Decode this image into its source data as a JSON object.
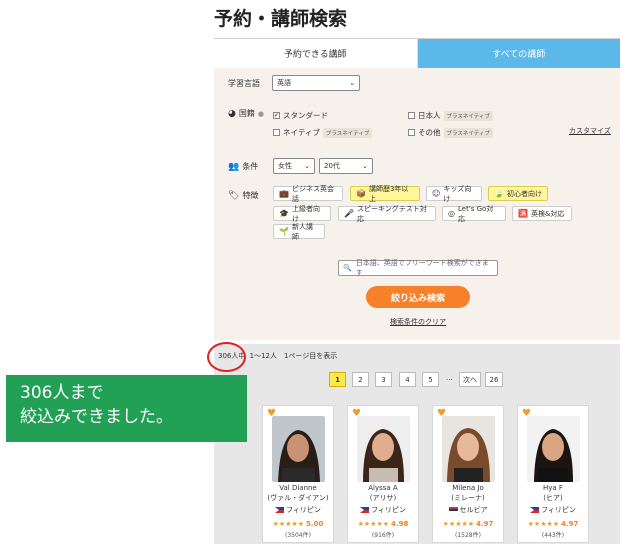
{
  "page_title": "予約・講師検索",
  "tabs": [
    {
      "label": "予約できる講師",
      "active": false
    },
    {
      "label": "すべての講師",
      "active": true
    }
  ],
  "filters": {
    "language_label": "学習言語",
    "language_value": "英語",
    "nationality_label": "国籍",
    "nationality_options": [
      {
        "label": "スタンダード",
        "checked": true,
        "badge": ""
      },
      {
        "label": "日本人",
        "checked": false,
        "badge": "プラスネイティブ"
      },
      {
        "label": "ネイティブ",
        "checked": false,
        "badge": "プラスネイティブ"
      },
      {
        "label": "その他",
        "checked": false,
        "badge": "プラスネイティブ"
      }
    ],
    "customize_link": "カスタマイズ",
    "condition_label": "条件",
    "gender_value": "女性",
    "age_value": "20代",
    "features_label": "特徴",
    "features": [
      {
        "label": "ビジネス英会話",
        "active": false,
        "icon": "briefcase-icon"
      },
      {
        "label": "講師歴3年以上",
        "active": true,
        "icon": "cube-icon"
      },
      {
        "label": "キッズ向け",
        "active": false,
        "icon": "smile-icon"
      },
      {
        "label": "初心者向け",
        "active": true,
        "icon": "leaf-icon"
      },
      {
        "label": "上級者向け",
        "active": false,
        "icon": "graduation-cap-icon"
      },
      {
        "label": "スピーキングテスト対応",
        "active": false,
        "icon": "microphone-icon"
      },
      {
        "label": "Let's Go対応",
        "active": false,
        "icon": "go-icon"
      },
      {
        "label": "英検&対応",
        "active": false,
        "icon": "eiken-icon"
      },
      {
        "label": "新人講師",
        "active": false,
        "icon": "sprout-icon"
      }
    ],
    "search_placeholder": "日本語、英語でフリーワード検索ができます",
    "search_button": "絞り込み検索",
    "clear_link": "検索条件のクリア"
  },
  "results": {
    "count_text": "306人中",
    "range_text": "1～12人　1ページ目を表示"
  },
  "pagination": {
    "pages": [
      "1",
      "2",
      "3",
      "4",
      "5"
    ],
    "current": "1",
    "ellipsis": "...",
    "next": "次へ",
    "last": "26"
  },
  "teachers": [
    {
      "name": "Val Dianne",
      "name_ja": "(ヴァル・ダイアン)",
      "country": "フィリピン",
      "rating": "5.00",
      "stars": 5,
      "reviews": "(3504件)"
    },
    {
      "name": "Alyssa A",
      "name_ja": "(アリサ)",
      "country": "フィリピン",
      "rating": "4.98",
      "stars": 5,
      "reviews": "(916件)"
    },
    {
      "name": "Milena Jo",
      "name_ja": "(ミレーナ)",
      "country": "セルビア",
      "rating": "4.97",
      "stars": 5,
      "reviews": "(1528件)"
    },
    {
      "name": "Hya F",
      "name_ja": "(ヒア)",
      "country": "フィリピン",
      "rating": "4.97",
      "stars": 5,
      "reviews": "(443件)"
    }
  ],
  "callout": {
    "line1": "306人まで",
    "line2": "絞込みできました。"
  },
  "colors": {
    "accent_blue": "#5bb8e8",
    "accent_orange": "#f7812a",
    "callout_green": "#22a055",
    "highlight_red": "#e02020"
  }
}
